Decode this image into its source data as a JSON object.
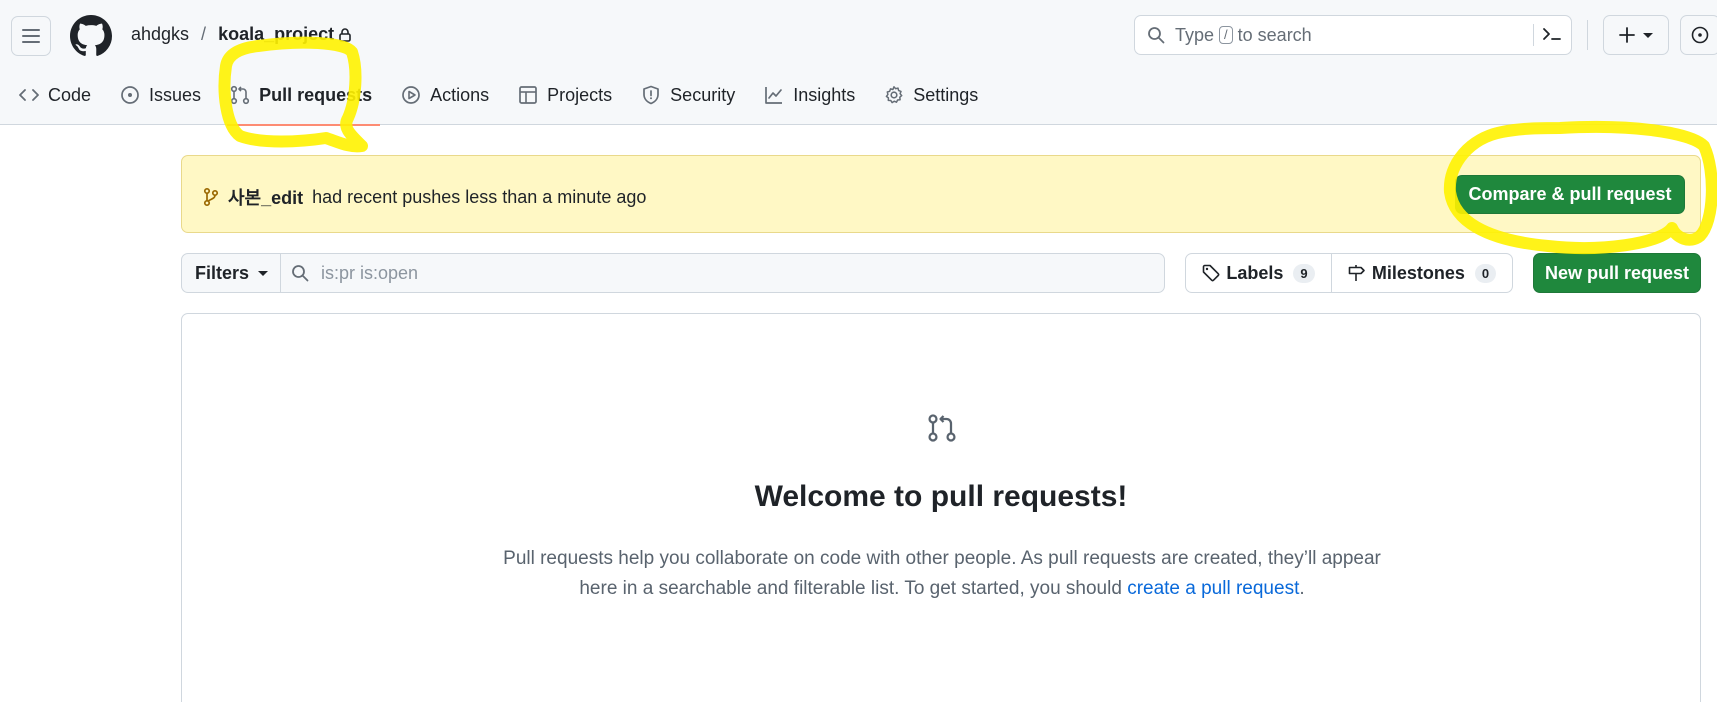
{
  "header": {
    "owner": "ahdgks",
    "separator": "/",
    "repo": "koala_project",
    "search": {
      "prefix": "Type",
      "key": "/",
      "suffix": "to search"
    }
  },
  "tabs": [
    {
      "label": "Code",
      "icon": "code-icon"
    },
    {
      "label": "Issues",
      "icon": "issue-opened-icon"
    },
    {
      "label": "Pull requests",
      "icon": "git-pull-request-icon",
      "active": true
    },
    {
      "label": "Actions",
      "icon": "play-icon"
    },
    {
      "label": "Projects",
      "icon": "table-icon"
    },
    {
      "label": "Security",
      "icon": "shield-icon"
    },
    {
      "label": "Insights",
      "icon": "graph-icon"
    },
    {
      "label": "Settings",
      "icon": "gear-icon"
    }
  ],
  "banner": {
    "branch": "사본_edit",
    "message": "had recent pushes less than a minute ago",
    "button": "Compare & pull request"
  },
  "filters": {
    "button": "Filters",
    "query": "is:pr is:open",
    "labels": {
      "label": "Labels",
      "count": "9"
    },
    "milestones": {
      "label": "Milestones",
      "count": "0"
    },
    "new_button": "New pull request"
  },
  "blankslate": {
    "title": "Welcome to pull requests!",
    "body": "Pull requests help you collaborate on code with other people. As pull requests are created, they’ll appear here in a searchable and filterable list. To get started, you should",
    "link": "create a pull request",
    "end": "."
  },
  "colors": {
    "primary_button": "#1f883d",
    "banner_bg": "#fff8c5",
    "link": "#0969da",
    "active_underline": "#fd8c73",
    "annotation_marker": "#fff200"
  }
}
